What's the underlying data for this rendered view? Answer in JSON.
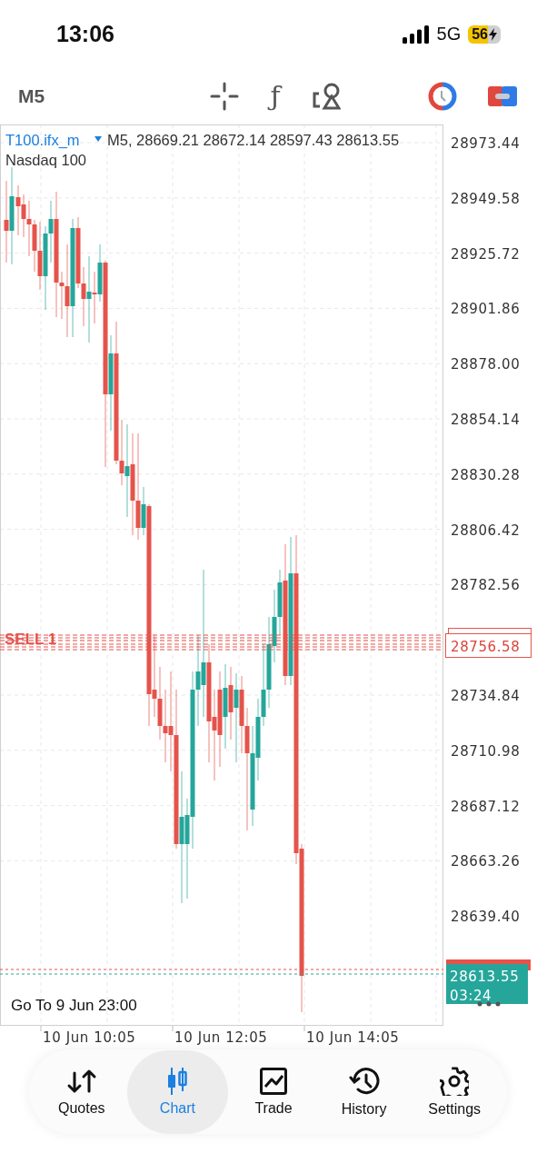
{
  "status_bar": {
    "time": "13:06",
    "network": "5G",
    "battery": "56"
  },
  "toolbar": {
    "timeframe": "M5",
    "function_symbol": "ƒ"
  },
  "chart": {
    "symbol": "T100.ifx_m",
    "header": "M5, 28669.21 28672.14 28597.43 28613.55",
    "description": "Nasdaq 100",
    "price_ticks": [
      "28973.44",
      "28949.58",
      "28925.72",
      "28901.86",
      "28878.00",
      "28854.14",
      "28830.28",
      "28806.42",
      "28782.56",
      "28734.84",
      "28710.98",
      "28687.12",
      "28663.26",
      "28639.40"
    ],
    "time_ticks": [
      "10 Jun 10:05",
      "10 Jun 12:05",
      "10 Jun 14:05"
    ],
    "order_line": {
      "label": "SELL 1",
      "price": "28756.58"
    },
    "current_price": "28613.55",
    "countdown": "03:24",
    "goto": "Go To 9 Jun 23:00"
  },
  "tabs": [
    {
      "label": "Quotes",
      "selected": false
    },
    {
      "label": "Chart",
      "selected": true
    },
    {
      "label": "Trade",
      "selected": false
    },
    {
      "label": "History",
      "selected": false
    },
    {
      "label": "Settings",
      "selected": false
    }
  ]
}
